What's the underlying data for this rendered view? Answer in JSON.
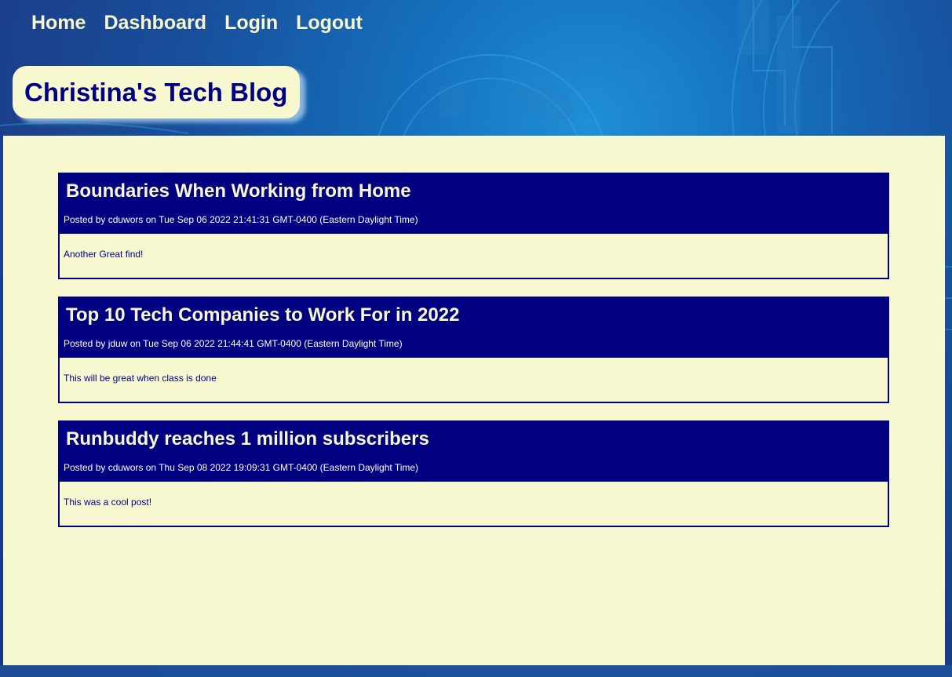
{
  "nav": {
    "items": [
      {
        "label": "Home"
      },
      {
        "label": "Dashboard"
      },
      {
        "label": "Login"
      },
      {
        "label": "Logout"
      }
    ]
  },
  "header": {
    "title": "Christina's Tech Blog"
  },
  "posts": [
    {
      "title": "Boundaries When Working from Home",
      "meta": "Posted by cduwors on Tue Sep 06 2022 21:41:31 GMT-0400 (Eastern Daylight Time)",
      "comment": "Another Great find!"
    },
    {
      "title": "Top 10 Tech Companies to Work For in 2022",
      "meta": "Posted by jduw on Tue Sep 06 2022 21:44:41 GMT-0400 (Eastern Daylight Time)",
      "comment": "This will be great when class is done"
    },
    {
      "title": "Runbuddy reaches 1 million subscribers",
      "meta": "Posted by cduwors on Thu Sep 08 2022 19:09:31 GMT-0400 (Eastern Daylight Time)",
      "comment": "This was a cool post!"
    }
  ],
  "colors": {
    "navy": "#000080",
    "cream": "#f8f8d0",
    "background_blue": "#1b3f8a"
  }
}
